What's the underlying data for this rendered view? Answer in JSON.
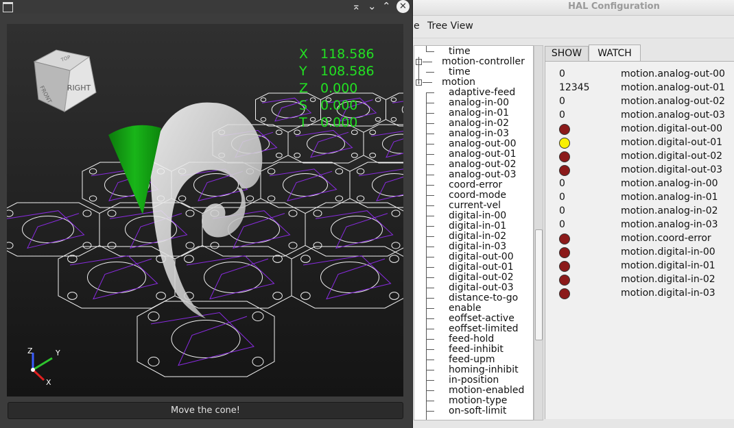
{
  "cone_window": {
    "title_buttons": {
      "keep_above": "⌅",
      "minimize": "⌄",
      "maximize": "⌃",
      "close": "✕"
    },
    "move_button_label": "Move the cone!",
    "view_cube": {
      "front_face": "RIGHT",
      "side_face": "FRONT",
      "top_face": "TOP"
    },
    "axis_triad": {
      "x": "X",
      "y": "Y",
      "z": "Z"
    },
    "dro": [
      {
        "axis": "X",
        "value": "118.586"
      },
      {
        "axis": "Y",
        "value": "108.586"
      },
      {
        "axis": "Z",
        "value": "0.000"
      },
      {
        "axis": "S",
        "value": "0.000"
      },
      {
        "axis": "T",
        "value": "0.000"
      }
    ],
    "colors": {
      "dro": "#22e022",
      "cone": "#11aa11",
      "toolpath": "#8a2be2",
      "geometry": "#ffffff"
    }
  },
  "hal_window": {
    "title": "HAL Configuration",
    "menu": {
      "partial": "e",
      "tree_view": "Tree View"
    },
    "tree": [
      {
        "label": "time",
        "level": 2
      },
      {
        "label": "motion-controller",
        "level": 1,
        "expander": "-"
      },
      {
        "label": "time",
        "level": 2
      },
      {
        "label": "motion",
        "level": 1,
        "expander": "-"
      },
      {
        "label": "adaptive-feed",
        "level": 2
      },
      {
        "label": "analog-in-00",
        "level": 2
      },
      {
        "label": "analog-in-01",
        "level": 2
      },
      {
        "label": "analog-in-02",
        "level": 2
      },
      {
        "label": "analog-in-03",
        "level": 2
      },
      {
        "label": "analog-out-00",
        "level": 2
      },
      {
        "label": "analog-out-01",
        "level": 2
      },
      {
        "label": "analog-out-02",
        "level": 2
      },
      {
        "label": "analog-out-03",
        "level": 2
      },
      {
        "label": "coord-error",
        "level": 2
      },
      {
        "label": "coord-mode",
        "level": 2
      },
      {
        "label": "current-vel",
        "level": 2
      },
      {
        "label": "digital-in-00",
        "level": 2
      },
      {
        "label": "digital-in-01",
        "level": 2
      },
      {
        "label": "digital-in-02",
        "level": 2
      },
      {
        "label": "digital-in-03",
        "level": 2
      },
      {
        "label": "digital-out-00",
        "level": 2
      },
      {
        "label": "digital-out-01",
        "level": 2
      },
      {
        "label": "digital-out-02",
        "level": 2
      },
      {
        "label": "digital-out-03",
        "level": 2
      },
      {
        "label": "distance-to-go",
        "level": 2
      },
      {
        "label": "enable",
        "level": 2
      },
      {
        "label": "eoffset-active",
        "level": 2
      },
      {
        "label": "eoffset-limited",
        "level": 2
      },
      {
        "label": "feed-hold",
        "level": 2
      },
      {
        "label": "feed-inhibit",
        "level": 2
      },
      {
        "label": "feed-upm",
        "level": 2
      },
      {
        "label": "homing-inhibit",
        "level": 2
      },
      {
        "label": "in-position",
        "level": 2
      },
      {
        "label": "motion-enabled",
        "level": 2
      },
      {
        "label": "motion-type",
        "level": 2
      },
      {
        "label": "on-soft-limit",
        "level": 2
      }
    ],
    "tabs": [
      "SHOW",
      "WATCH"
    ],
    "active_tab": "WATCH",
    "watch": [
      {
        "value": "0",
        "name": "motion.analog-out-00"
      },
      {
        "value": "12345",
        "name": "motion.analog-out-01"
      },
      {
        "value": "0",
        "name": "motion.analog-out-02"
      },
      {
        "value": "0",
        "name": "motion.analog-out-03"
      },
      {
        "led": "off",
        "name": "motion.digital-out-00"
      },
      {
        "led": "on",
        "name": "motion.digital-out-01"
      },
      {
        "led": "off",
        "name": "motion.digital-out-02"
      },
      {
        "led": "off",
        "name": "motion.digital-out-03"
      },
      {
        "value": "0",
        "name": "motion.analog-in-00"
      },
      {
        "value": "0",
        "name": "motion.analog-in-01"
      },
      {
        "value": "0",
        "name": "motion.analog-in-02"
      },
      {
        "value": "0",
        "name": "motion.analog-in-03"
      },
      {
        "led": "off",
        "name": "motion.coord-error"
      },
      {
        "led": "off",
        "name": "motion.digital-in-00"
      },
      {
        "led": "off",
        "name": "motion.digital-in-01"
      },
      {
        "led": "off",
        "name": "motion.digital-in-02"
      },
      {
        "led": "off",
        "name": "motion.digital-in-03"
      }
    ],
    "led_colors": {
      "on": "#f8f000",
      "off": "#8b1a1a"
    }
  }
}
